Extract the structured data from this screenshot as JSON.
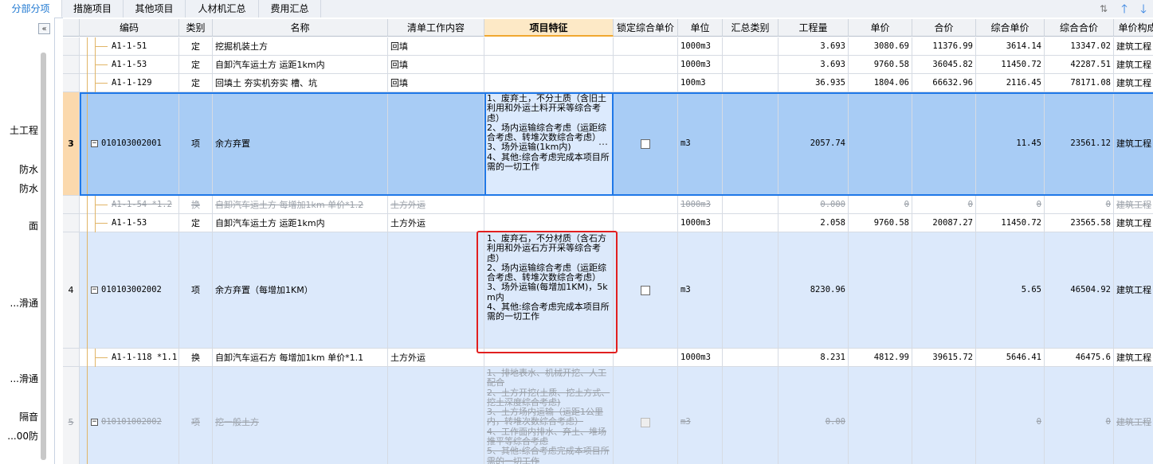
{
  "tabs": [
    {
      "label": "分部分项",
      "active": true
    },
    {
      "label": "措施项目",
      "active": false
    },
    {
      "label": "其他项目",
      "active": false
    },
    {
      "label": "人材机汇总",
      "active": false
    },
    {
      "label": "费用汇总",
      "active": false
    }
  ],
  "toolbar_icons": [
    "sort-icon",
    "arrow-up-icon",
    "arrow-down-icon"
  ],
  "left_tree": [
    "土工程",
    "防水",
    "防水",
    "面",
    "滑通...",
    "滑通...",
    "隔音",
    "00防..."
  ],
  "columns": [
    "编码",
    "类别",
    "名称",
    "清单工作内容",
    "项目特征",
    "锁定综合单价",
    "单位",
    "汇总类别",
    "工程量",
    "单价",
    "合价",
    "综合单价",
    "综合合价",
    "单价构成"
  ],
  "rows": [
    {
      "num": "",
      "code": "A1-1-51",
      "type": "定",
      "name": "挖掘机装土方",
      "work": "回填",
      "feature": "",
      "unit": "1000m3",
      "qty": "3.693",
      "price": "3080.69",
      "total": "11376.99",
      "cprice": "3614.14",
      "ctotal": "13347.02",
      "comp": "建筑工程",
      "kind": "sub"
    },
    {
      "num": "",
      "code": "A1-1-53",
      "type": "定",
      "name": "自卸汽车运土方 运距1km内",
      "work": "回填",
      "feature": "",
      "unit": "1000m3",
      "qty": "3.693",
      "price": "9760.58",
      "total": "36045.82",
      "cprice": "11450.72",
      "ctotal": "42287.51",
      "comp": "建筑工程",
      "kind": "sub"
    },
    {
      "num": "",
      "code": "A1-1-129",
      "type": "定",
      "name": "回填土 夯实机夯实 槽、坑",
      "work": "回填",
      "feature": "",
      "unit": "100m3",
      "qty": "36.935",
      "price": "1804.06",
      "total": "66632.96",
      "cprice": "2116.45",
      "ctotal": "78171.08",
      "comp": "建筑工程",
      "kind": "sub"
    },
    {
      "num": "3",
      "code": "010103002001",
      "type": "项",
      "name": "余方弃置",
      "work": "",
      "feature": "1、废弃土，不分土质（含旧土利用和外运土料开采等综合考虑）\n2、场内运输综合考虑（运距综合考虑、转堆次数综合考虑）\n3、场外运输(1km内)\n4、其他:综合考虑完成本项目所需的一切工作",
      "unit": "m3",
      "qty": "2057.74",
      "price": "",
      "total": "",
      "cprice": "11.45",
      "ctotal": "23561.12",
      "comp": "建筑工程",
      "kind": "selected"
    },
    {
      "num": "",
      "code": "A1-1-54 *1.2",
      "type": "换",
      "name": "自卸汽车运土方 每增加1km  单价*1.2",
      "work": "土方外运",
      "feature": "",
      "unit": "1000m3",
      "qty": "0.000",
      "price": "0",
      "total": "0",
      "cprice": "0",
      "ctotal": "0",
      "comp": "建筑工程",
      "kind": "struck"
    },
    {
      "num": "",
      "code": "A1-1-53",
      "type": "定",
      "name": "自卸汽车运土方 运距1km内",
      "work": "土方外运",
      "feature": "",
      "unit": "1000m3",
      "qty": "2.058",
      "price": "9760.58",
      "total": "20087.27",
      "cprice": "11450.72",
      "ctotal": "23565.58",
      "comp": "建筑工程",
      "kind": "sub"
    },
    {
      "num": "4",
      "code": "010103002002",
      "type": "项",
      "name": "余方弃置（每增加1KM）",
      "work": "",
      "feature": "1、废弃石，不分材质（含石方利用和外运石方开采等综合考虑）\n2、场内运输综合考虑（运距综合考虑、转堆次数综合考虑）\n3、场外运输(每增加1KM)，5km内\n4、其他:综合考虑完成本项目所需的一切工作",
      "unit": "m3",
      "qty": "8230.96",
      "price": "",
      "total": "",
      "cprice": "5.65",
      "ctotal": "46504.92",
      "comp": "建筑工程",
      "kind": "item"
    },
    {
      "num": "",
      "code": "A1-1-118 *1.1",
      "type": "换",
      "name": "自卸汽车运石方 每增加1km  单价*1.1",
      "work": "土方外运",
      "feature": "",
      "unit": "1000m3",
      "qty": "8.231",
      "price": "4812.99",
      "total": "39615.72",
      "cprice": "5646.41",
      "ctotal": "46475.6",
      "comp": "建筑工程",
      "kind": "sub"
    },
    {
      "num": "5",
      "code": "010101002002",
      "type": "项",
      "name": "挖一般土方",
      "work": "",
      "feature": "1、排地表水、机械开挖、人工配合\n2、土方开挖(土质、挖土方式、挖土深度综合考虑)\n3、土方场内运输（运距1公里内，转堆次数综合考虑）\n4、工作面内排水、弃土、堆场推平等综合考虑\n5、其他:综合考虑完成本项目所需的一切工作",
      "unit": "m3",
      "qty": "0.00",
      "price": "",
      "total": "",
      "cprice": "0",
      "ctotal": "0",
      "comp": "建筑工程",
      "kind": "item-struck"
    }
  ]
}
